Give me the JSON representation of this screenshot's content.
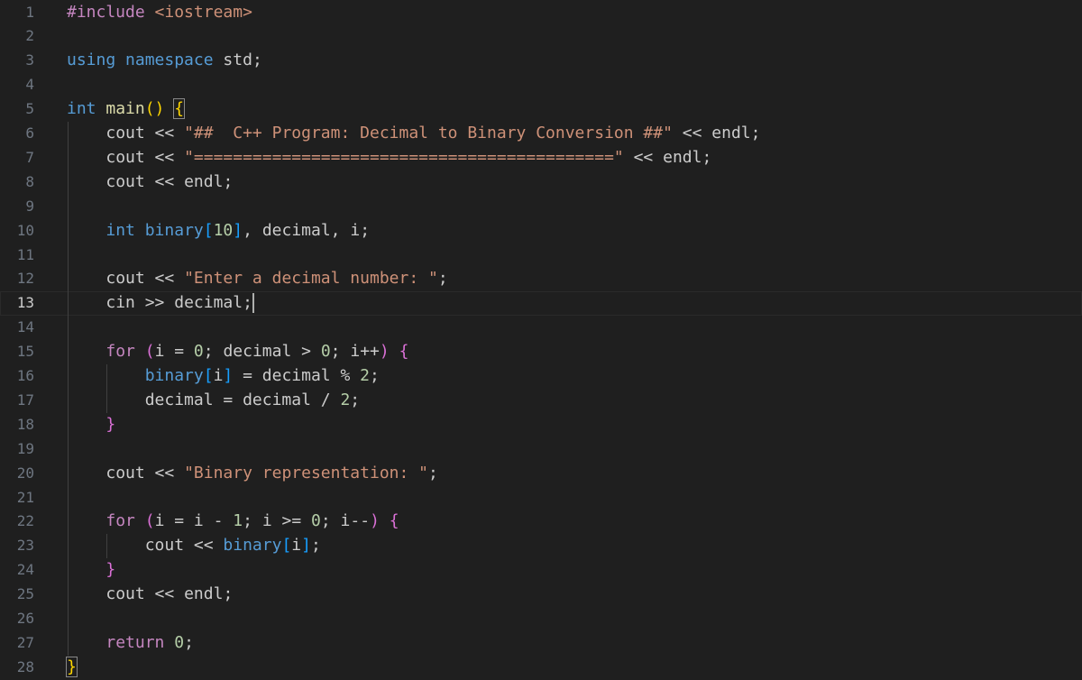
{
  "editor": {
    "language": "cpp",
    "current_line": 13,
    "lines": [
      {
        "n": "1",
        "text": "#include <iostream>"
      },
      {
        "n": "2",
        "text": ""
      },
      {
        "n": "3",
        "text": "using namespace std;"
      },
      {
        "n": "4",
        "text": ""
      },
      {
        "n": "5",
        "text": "int main() {"
      },
      {
        "n": "6",
        "text": "    cout << \"##  C++ Program: Decimal to Binary Conversion ##\" << endl;"
      },
      {
        "n": "7",
        "text": "    cout << \"===========================================\" << endl;"
      },
      {
        "n": "8",
        "text": "    cout << endl;"
      },
      {
        "n": "9",
        "text": ""
      },
      {
        "n": "10",
        "text": "    int binary[10], decimal, i;"
      },
      {
        "n": "11",
        "text": ""
      },
      {
        "n": "12",
        "text": "    cout << \"Enter a decimal number: \";"
      },
      {
        "n": "13",
        "text": "    cin >> decimal;"
      },
      {
        "n": "14",
        "text": ""
      },
      {
        "n": "15",
        "text": "    for (i = 0; decimal > 0; i++) {"
      },
      {
        "n": "16",
        "text": "        binary[i] = decimal % 2;"
      },
      {
        "n": "17",
        "text": "        decimal = decimal / 2;"
      },
      {
        "n": "18",
        "text": "    }"
      },
      {
        "n": "19",
        "text": ""
      },
      {
        "n": "20",
        "text": "    cout << \"Binary representation: \";"
      },
      {
        "n": "21",
        "text": ""
      },
      {
        "n": "22",
        "text": "    for (i = i - 1; i >= 0; i--) {"
      },
      {
        "n": "23",
        "text": "        cout << binary[i];"
      },
      {
        "n": "24",
        "text": "    }"
      },
      {
        "n": "25",
        "text": "    cout << endl;"
      },
      {
        "n": "26",
        "text": ""
      },
      {
        "n": "27",
        "text": "    return 0;"
      },
      {
        "n": "28",
        "text": "}"
      }
    ]
  },
  "colors": {
    "background": "#1f1f1f",
    "keyword": "#569cd6",
    "control": "#c586c0",
    "string": "#ce9178",
    "number": "#b5cea8",
    "function": "#dcdcaa",
    "variable": "#9cdcfe",
    "line_number": "#6e7681"
  }
}
